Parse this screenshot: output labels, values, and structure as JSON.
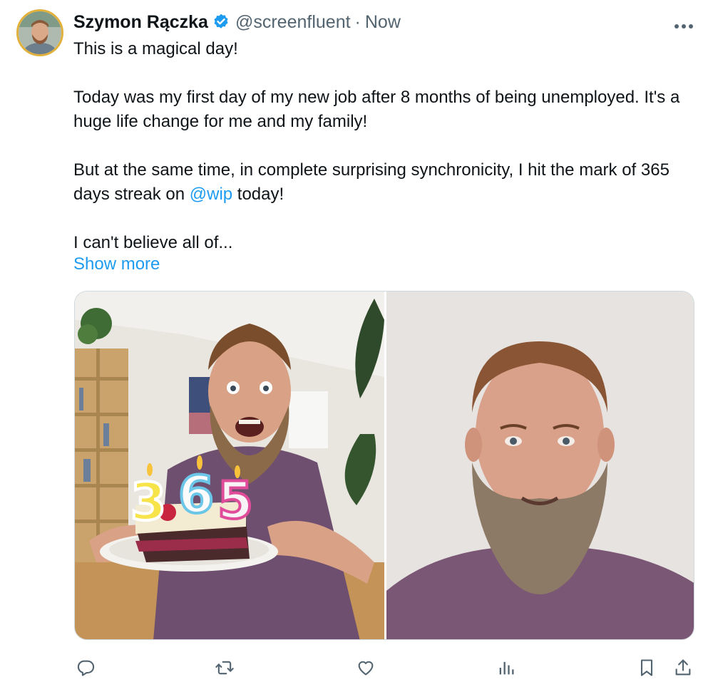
{
  "tweet": {
    "author": {
      "name": "Szymon Rączka",
      "handle": "@screenfluent",
      "separator": "·",
      "time": "Now",
      "avatar_icon": "profile-photo",
      "verified_icon": "verified-badge-icon",
      "verified_color": "#1d9bf0"
    },
    "more_icon": "more-options-icon",
    "text": {
      "line1": "This is a magical day!",
      "para2": "Today was my first day of my new job after 8 months of being unemployed. It's a huge life change for me and my family!",
      "para3_before": "But at the same time, in complete surprising synchronicity, I hit the mark of 365 days streak on ",
      "mention": "@wip",
      "para3_after": " today!",
      "para4": "I can't believe all of..."
    },
    "show_more": "Show more",
    "media": [
      {
        "icon": "photo-birthday-cake-365-candles"
      },
      {
        "icon": "photo-smiling-bearded-man"
      }
    ],
    "actions": [
      {
        "icon": "reply-icon"
      },
      {
        "icon": "retweet-icon"
      },
      {
        "icon": "like-icon"
      },
      {
        "icon": "views-icon"
      },
      {
        "icon": "bookmark-icon"
      },
      {
        "icon": "share-icon"
      }
    ],
    "colors": {
      "text": "#0f1419",
      "secondary": "#536471",
      "link": "#1d9bf0",
      "avatar_ring": "#e2b13c"
    }
  }
}
